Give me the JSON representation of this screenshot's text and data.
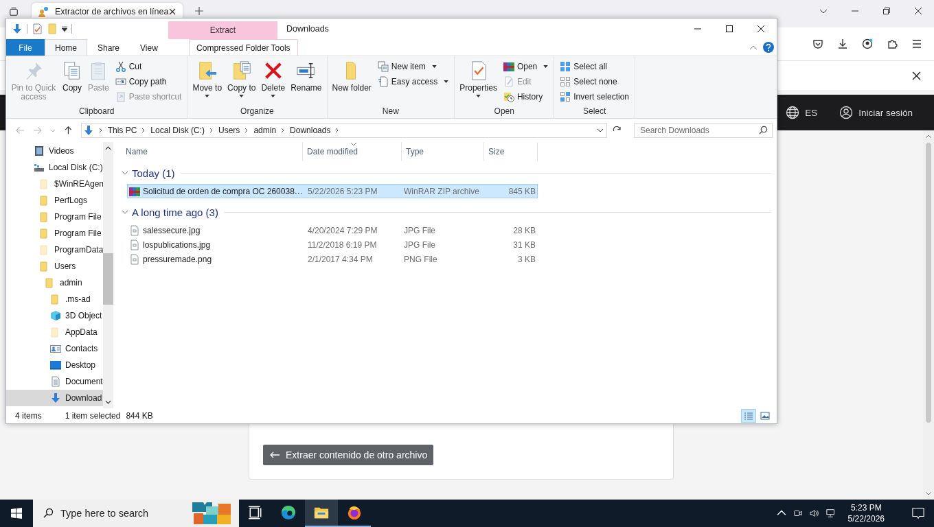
{
  "browser": {
    "tab_title": "Extractor de archivos en línea",
    "language": "ES",
    "sign_in": "Iniciar sesión",
    "back_button": "Extraer contenido de otro archivo"
  },
  "explorer": {
    "title": "Downloads",
    "context_group": "Extract",
    "tabs": [
      {
        "label": "File",
        "kind": "file",
        "selected": false
      },
      {
        "label": "Home",
        "kind": "tab",
        "selected": true
      },
      {
        "label": "Share",
        "kind": "tab",
        "selected": false
      },
      {
        "label": "View",
        "kind": "tab",
        "selected": false
      },
      {
        "label": "Compressed Folder Tools",
        "kind": "context",
        "selected": false
      }
    ],
    "ribbon": [
      {
        "label": "Clipboard",
        "items": [
          {
            "kind": "large",
            "label": "Pin to Quick access",
            "disabled": true,
            "dropdown": false
          },
          {
            "kind": "large",
            "label": "Copy",
            "disabled": false,
            "dropdown": false
          },
          {
            "kind": "large",
            "label": "Paste",
            "disabled": true,
            "dropdown": false
          },
          {
            "kind": "stack",
            "items": [
              {
                "label": "Cut",
                "disabled": false,
                "dropdown": false
              },
              {
                "label": "Copy path",
                "disabled": false,
                "dropdown": false
              },
              {
                "label": "Paste shortcut",
                "disabled": true,
                "dropdown": false
              }
            ]
          }
        ]
      },
      {
        "label": "Organize",
        "items": [
          {
            "kind": "large",
            "label": "Move to",
            "disabled": false,
            "dropdown": true
          },
          {
            "kind": "large",
            "label": "Copy to",
            "disabled": false,
            "dropdown": true
          },
          {
            "kind": "large",
            "label": "Delete",
            "disabled": false,
            "dropdown": true
          },
          {
            "kind": "large",
            "label": "Rename",
            "disabled": false,
            "dropdown": false
          }
        ]
      },
      {
        "label": "New",
        "items": [
          {
            "kind": "large",
            "label": "New folder",
            "disabled": false,
            "dropdown": false
          },
          {
            "kind": "stack",
            "items": [
              {
                "label": "New item",
                "disabled": false,
                "dropdown": true
              },
              {
                "label": "Easy access",
                "disabled": false,
                "dropdown": true
              }
            ]
          }
        ]
      },
      {
        "label": "Open",
        "items": [
          {
            "kind": "large",
            "label": "Properties",
            "disabled": false,
            "dropdown": true
          },
          {
            "kind": "stack",
            "items": [
              {
                "label": "Open",
                "disabled": false,
                "dropdown": true
              },
              {
                "label": "Edit",
                "disabled": true,
                "dropdown": false
              },
              {
                "label": "History",
                "disabled": false,
                "dropdown": false
              }
            ]
          }
        ]
      },
      {
        "label": "Select",
        "items": [
          {
            "kind": "stack",
            "items": [
              {
                "label": "Select all",
                "disabled": false,
                "dropdown": false
              },
              {
                "label": "Select none",
                "disabled": false,
                "dropdown": false
              },
              {
                "label": "Invert selection",
                "disabled": false,
                "dropdown": false
              }
            ]
          }
        ]
      }
    ],
    "path": [
      "This PC",
      "Local Disk (C:)",
      "Users",
      "admin",
      "Downloads"
    ],
    "search_placeholder": "Search Downloads",
    "tree": [
      {
        "label": "Videos",
        "kind": "video",
        "selected": false
      },
      {
        "label": "Local Disk (C:)",
        "kind": "drive",
        "selected": false,
        "children": [
          {
            "label": "$WinREAgen",
            "kind": "folder-hidden",
            "selected": false
          },
          {
            "label": "PerfLogs",
            "kind": "folder",
            "selected": false
          },
          {
            "label": "Program File",
            "kind": "folder",
            "selected": false
          },
          {
            "label": "Program File",
            "kind": "folder",
            "selected": false
          },
          {
            "label": "ProgramData",
            "kind": "folder-hidden",
            "selected": false
          },
          {
            "label": "Users",
            "kind": "folder",
            "selected": false,
            "children": [
              {
                "label": "admin",
                "kind": "folder",
                "selected": false,
                "children": [
                  {
                    "label": ".ms-ad",
                    "kind": "folder",
                    "selected": false
                  },
                  {
                    "label": "3D Object",
                    "kind": "cube",
                    "selected": false
                  },
                  {
                    "label": "AppData",
                    "kind": "folder-hidden",
                    "selected": false
                  },
                  {
                    "label": "Contacts",
                    "kind": "contacts",
                    "selected": false
                  },
                  {
                    "label": "Desktop",
                    "kind": "desktop",
                    "selected": false
                  },
                  {
                    "label": "Document",
                    "kind": "documents",
                    "selected": false
                  },
                  {
                    "label": "Download",
                    "kind": "downloads",
                    "selected": true
                  }
                ]
              }
            ]
          }
        ]
      }
    ],
    "columns": [
      {
        "label": "Name",
        "sorted": false
      },
      {
        "label": "Date modified",
        "sorted": true
      },
      {
        "label": "Type",
        "sorted": false
      },
      {
        "label": "Size",
        "sorted": false
      }
    ],
    "groups": [
      {
        "label": "Today (1)",
        "expanded": true,
        "files": [
          {
            "name": "Solicitud de orden de compra OC 260038…",
            "date": "5/22/2026 5:23 PM",
            "type": "WinRAR ZIP archive",
            "size": "845 KB",
            "kind": "archive",
            "selected": true
          }
        ]
      },
      {
        "label": "A long time ago (3)",
        "expanded": true,
        "files": [
          {
            "name": "salessecure.jpg",
            "date": "4/20/2024 7:29 PM",
            "type": "JPG File",
            "size": "28 KB",
            "kind": "image",
            "selected": false
          },
          {
            "name": "lospublications.jpg",
            "date": "11/2/2018 6:19 PM",
            "type": "JPG File",
            "size": "31 KB",
            "kind": "image",
            "selected": false
          },
          {
            "name": "pressuremade.png",
            "date": "2/1/2017 4:34 PM",
            "type": "PNG File",
            "size": "3 KB",
            "kind": "image",
            "selected": false
          }
        ]
      }
    ],
    "status": {
      "count": "4 items",
      "selection": "1 item selected",
      "selection_size": "844 KB"
    },
    "views": [
      {
        "kind": "details",
        "selected": true
      },
      {
        "kind": "large-icons",
        "selected": false
      }
    ]
  },
  "taskbar": {
    "search_placeholder": "Type here to search",
    "apps": [
      {
        "kind": "task-view",
        "active": false,
        "running": false
      },
      {
        "kind": "edge",
        "active": false,
        "running": false
      },
      {
        "kind": "explorer",
        "active": true,
        "running": true
      },
      {
        "kind": "firefox",
        "active": false,
        "running": true
      }
    ],
    "time": "5:23 PM",
    "date": "5/22/2026"
  }
}
